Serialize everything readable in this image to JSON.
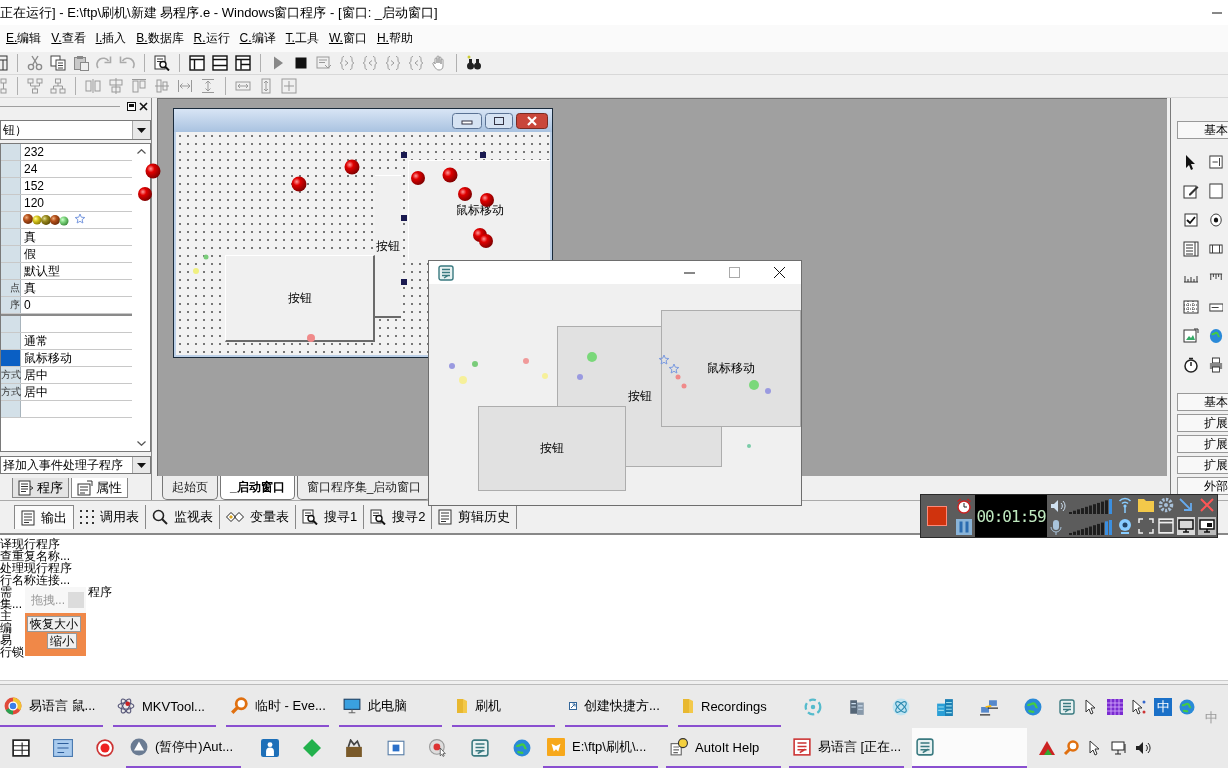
{
  "title_bar": {
    "title": "正在运行] - E:\\ftp\\刷机\\新建 易程序.e - Windows窗口程序 - [窗口: _启动窗口]"
  },
  "menu": [
    "E.编辑",
    "V.查看",
    "I.插入",
    "B.数据库",
    "R.运行",
    "C.编译",
    "T.工具",
    "W.窗口",
    "H.帮助"
  ],
  "property_panel": {
    "object_combo": "钮）",
    "rows": [
      {
        "value": "232",
        "selected": false
      },
      {
        "value": "24",
        "selected": false
      },
      {
        "value": "152",
        "selected": false
      },
      {
        "value": "120",
        "selected": false
      },
      {
        "selected": false
      },
      {
        "value": "真",
        "selected": false
      },
      {
        "value": "假",
        "selected": false
      },
      {
        "value": "默认型",
        "selected": false
      },
      {
        "label": "点",
        "value": "真",
        "selected": false
      },
      {
        "label": "序",
        "value": "0",
        "selected": false
      },
      {
        "selected": false
      },
      {
        "value": "通常",
        "selected": false
      },
      {
        "value": "鼠标移动",
        "selected": true
      },
      {
        "label": "方式",
        "value": "居中",
        "selected": false
      },
      {
        "label": "方式",
        "value": "居中",
        "selected": false
      },
      {
        "selected": false
      }
    ],
    "event_combo": "择加入事件处理子程序",
    "tabs": [
      {
        "label": "程序",
        "selected": false
      },
      {
        "label": "属性",
        "selected": true
      }
    ]
  },
  "designer": {
    "form_controls": [
      {
        "label": "按钮",
        "selected": false
      },
      {
        "label": "按钮",
        "selected": false
      },
      {
        "label": "鼠标移动",
        "selected": true
      }
    ],
    "tabs": [
      {
        "label": "起始页",
        "selected": false
      },
      {
        "label": "_启动窗口",
        "selected": true
      },
      {
        "label": "窗口程序集_启动窗口",
        "selected": false
      }
    ]
  },
  "running_window": {
    "controls": [
      {
        "label": "按钮"
      },
      {
        "label": "按钮"
      },
      {
        "label": "鼠标移动"
      }
    ]
  },
  "toolbox": {
    "header": "基本",
    "sections": [
      "基本",
      "扩展",
      "扩展",
      "扩展",
      "外部"
    ]
  },
  "output_tabs": [
    {
      "label": "输出",
      "selected": true
    },
    {
      "label": "调用表",
      "selected": false
    },
    {
      "label": "监视表",
      "selected": false
    },
    {
      "label": "变量表",
      "selected": false
    },
    {
      "label": "搜寻1",
      "selected": false
    },
    {
      "label": "搜寻2",
      "selected": false
    },
    {
      "label": "剪辑历史",
      "selected": false
    }
  ],
  "output": {
    "lines": [
      {
        "text": "译现行程序"
      },
      {
        "text": "查重复名称..."
      },
      {
        "text": "处理现行程序"
      },
      {
        "text": "行名称连接..."
      },
      {
        "text": "需",
        "tail": "程序"
      },
      {
        "text": "集..."
      },
      {
        "text": "主"
      },
      {
        "text": "编"
      },
      {
        "text": "易"
      },
      {
        "text": "行锁"
      }
    ]
  },
  "drag_popup": {
    "hint": "拖拽...",
    "buttons": [
      "恢复大小",
      "缩小"
    ]
  },
  "recorder": {
    "time": "00:01:59"
  },
  "taskbar": {
    "top_row": [
      {
        "kind": "app",
        "label": "易语言 鼠...",
        "selected": false
      },
      {
        "kind": "app",
        "label": "MKVTool...",
        "selected": false
      },
      {
        "kind": "app",
        "label": "临时 - Eve...",
        "selected": false
      },
      {
        "kind": "app",
        "label": "此电脑",
        "selected": false
      },
      {
        "kind": "app",
        "label": "刷机",
        "selected": false
      },
      {
        "kind": "app",
        "label": "创建快捷方...",
        "selected": false
      },
      {
        "kind": "app",
        "label": "Recordings",
        "selected": false
      },
      {
        "kind": "icon"
      },
      {
        "kind": "icon"
      },
      {
        "kind": "icon"
      },
      {
        "kind": "icon"
      },
      {
        "kind": "icon"
      },
      {
        "kind": "icon"
      },
      {
        "kind": "tray"
      },
      {
        "kind": "tray"
      },
      {
        "kind": "tray"
      },
      {
        "kind": "tray"
      },
      {
        "kind": "glyph",
        "label": "中"
      },
      {
        "kind": "tray"
      }
    ],
    "bottom_row": [
      {
        "kind": "icon"
      },
      {
        "kind": "icon"
      },
      {
        "kind": "icon"
      },
      {
        "kind": "app",
        "label": "(暂停中)Aut...",
        "selected": false
      },
      {
        "kind": "icon"
      },
      {
        "kind": "icon"
      },
      {
        "kind": "icon"
      },
      {
        "kind": "icon"
      },
      {
        "kind": "icon"
      },
      {
        "kind": "icon"
      },
      {
        "kind": "icon"
      },
      {
        "kind": "app",
        "label": "E:\\ftp\\刷机\\...",
        "selected": false
      },
      {
        "kind": "app",
        "label": "AutoIt Help",
        "selected": false
      },
      {
        "kind": "app",
        "label": "易语言 [正在...",
        "selected": false
      },
      {
        "kind": "app",
        "selected": true
      },
      {
        "kind": "tray"
      },
      {
        "kind": "tray"
      },
      {
        "kind": "tray"
      },
      {
        "kind": "tray"
      },
      {
        "kind": "tray"
      }
    ],
    "ime": "中"
  }
}
